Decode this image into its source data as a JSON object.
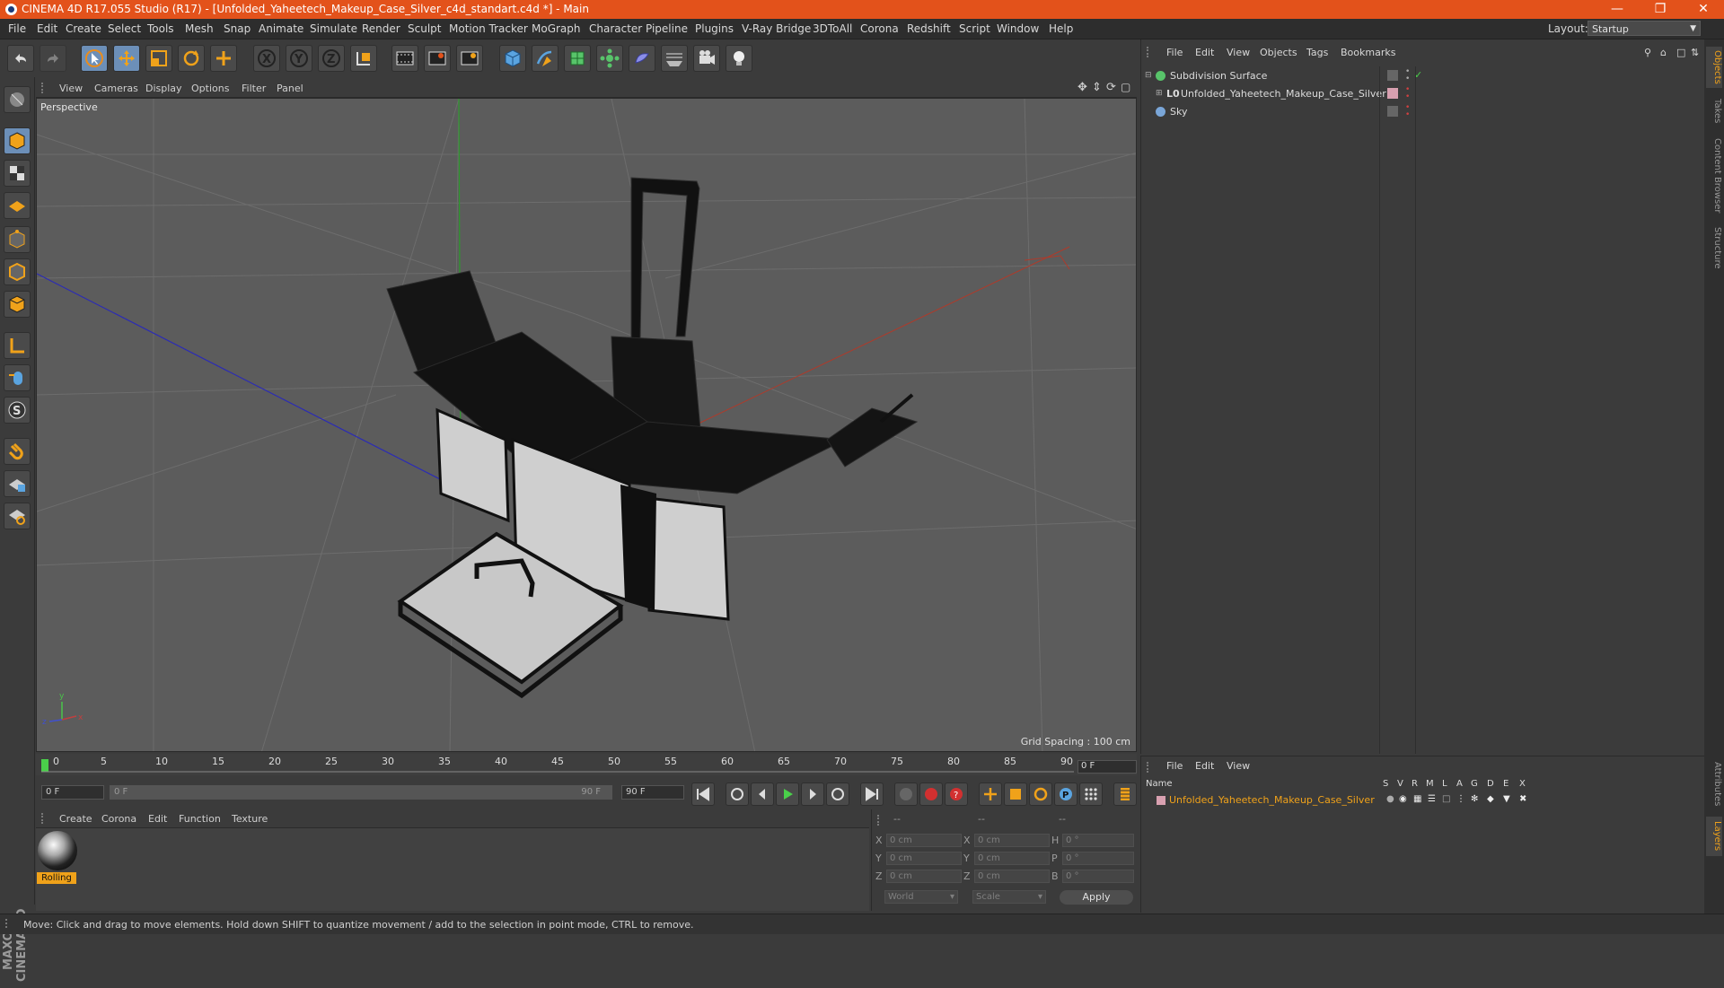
{
  "window": {
    "title": "CINEMA 4D R17.055 Studio (R17) - [Unfolded_Yaheetech_Makeup_Case_Silver_c4d_standart.c4d *] - Main",
    "controls": [
      "minimize",
      "restore",
      "close"
    ]
  },
  "menubar": {
    "items": [
      "File",
      "Edit",
      "Create",
      "Select",
      "Tools",
      "Mesh",
      "Snap",
      "Animate",
      "Simulate",
      "Render",
      "Sculpt",
      "Motion Tracker",
      "MoGraph",
      "Character",
      "Pipeline",
      "Plugins",
      "V-Ray Bridge",
      "3DToAll",
      "Corona",
      "Redshift",
      "Script",
      "Window",
      "Help"
    ],
    "layout_label": "Layout:",
    "layout_value": "Startup"
  },
  "toolbar": {
    "icons": [
      "undo-icon",
      "redo-icon",
      "select-arrow-icon",
      "move-icon",
      "scale-icon",
      "rotate-icon",
      "recent-tool-icon",
      "x-axis-icon",
      "y-axis-icon",
      "z-axis-icon",
      "coordinate-system-icon",
      "render-view-icon",
      "render-picture-viewer-icon",
      "edit-render-settings-icon",
      "cube-icon",
      "pen-icon",
      "subdivision-icon",
      "array-icon",
      "deformer-icon",
      "floor-icon",
      "camera-icon",
      "light-icon"
    ]
  },
  "viewport": {
    "menu": [
      "View",
      "Cameras",
      "Display",
      "Options",
      "Filter",
      "Panel"
    ],
    "label": "Perspective",
    "grid_spacing": "Grid Spacing : 100 cm"
  },
  "timeline": {
    "ticks": [
      "0",
      "5",
      "10",
      "15",
      "20",
      "25",
      "30",
      "35",
      "40",
      "45",
      "50",
      "55",
      "60",
      "65",
      "70",
      "75",
      "80",
      "85",
      "90"
    ],
    "current_frame": "0 F"
  },
  "transport": {
    "start_field": "0 F",
    "range_start": "0 F",
    "range_end": "90 F",
    "end_field": "90 F"
  },
  "material_manager": {
    "menu": [
      "Create",
      "Corona",
      "Edit",
      "Function",
      "Texture"
    ],
    "materials": [
      {
        "name": "Rolling"
      }
    ]
  },
  "coordinates": {
    "header": [
      "--",
      "--",
      "--"
    ],
    "rows": [
      {
        "axis": "X",
        "pos": "0 cm",
        "axis2": "X",
        "size": "0 cm",
        "rot_label": "H",
        "rot": "0 °"
      },
      {
        "axis": "Y",
        "pos": "0 cm",
        "axis2": "Y",
        "size": "0 cm",
        "rot_label": "P",
        "rot": "0 °"
      },
      {
        "axis": "Z",
        "pos": "0 cm",
        "axis2": "Z",
        "size": "0 cm",
        "rot_label": "B",
        "rot": "0 °"
      }
    ],
    "mode_world": "World",
    "mode_scale": "Scale",
    "apply": "Apply"
  },
  "object_manager": {
    "menu": [
      "File",
      "Edit",
      "View",
      "Objects",
      "Tags",
      "Bookmarks"
    ],
    "objects": [
      {
        "name": "Subdivision Surface",
        "color": "#dcdcdc"
      },
      {
        "name": "Unfolded_Yaheetech_Makeup_Case_Silver",
        "color": "#dcdcdc"
      },
      {
        "name": "Sky",
        "color": "#dcdcdc"
      }
    ]
  },
  "layer_manager": {
    "menu": [
      "File",
      "Edit",
      "View"
    ],
    "columns": [
      "Name",
      "S",
      "V",
      "R",
      "M",
      "L",
      "A",
      "G",
      "D",
      "E",
      "X"
    ],
    "layers": [
      {
        "name": "Unfolded_Yaheetech_Makeup_Case_Silver",
        "color": "#f0a21a"
      }
    ]
  },
  "side_tabs": [
    "Objects",
    "Takes",
    "Content Browser",
    "Structure",
    "Attributes",
    "Layers"
  ],
  "status": {
    "text": "Move: Click and drag to move elements. Hold down SHIFT to quantize movement / add to the selection in point mode, CTRL to remove."
  },
  "colors": {
    "titlebar": "#e3521b",
    "accent_orange": "#f0a21a",
    "active_tool": "#6c8fb8",
    "viewport_bg": "#5c5c5c"
  }
}
